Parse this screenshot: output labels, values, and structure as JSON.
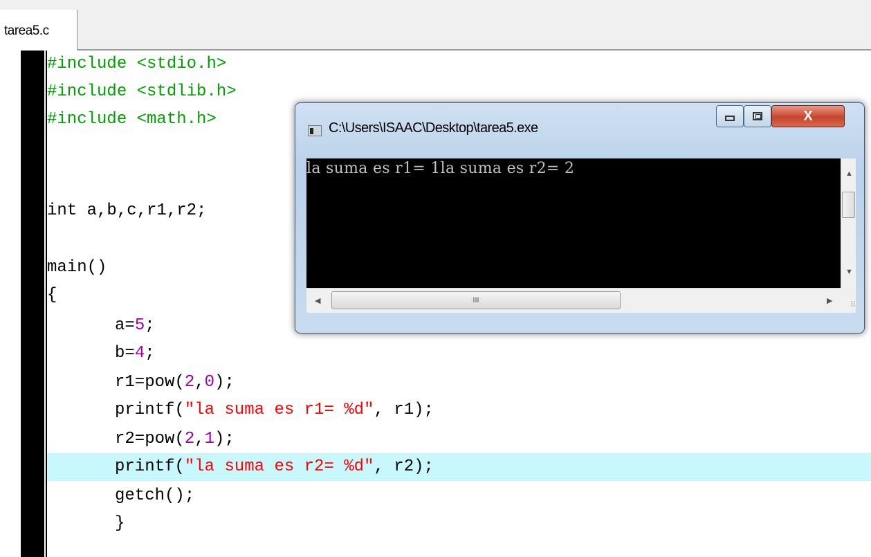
{
  "tab": {
    "label": "tarea5.c"
  },
  "code_lines": [
    {
      "segments": [
        {
          "cls": "pp",
          "text": "#include <stdio.h>"
        }
      ]
    },
    {
      "segments": [
        {
          "cls": "pp",
          "text": "#include <stdlib.h>"
        }
      ]
    },
    {
      "segments": [
        {
          "cls": "pp",
          "text": "#include <math.h>"
        }
      ]
    },
    {
      "segments": []
    },
    {
      "segments": []
    },
    {
      "segments": [
        {
          "cls": "",
          "text": "int a,b,c,r1,r2;"
        }
      ]
    },
    {
      "segments": []
    },
    {
      "segments": [
        {
          "cls": "",
          "text": "main()"
        }
      ]
    },
    {
      "segments": [
        {
          "cls": "",
          "text": "{"
        }
      ]
    },
    {
      "indent": true,
      "segments": [
        {
          "cls": "",
          "text": "a="
        },
        {
          "cls": "num",
          "text": "5"
        },
        {
          "cls": "",
          "text": ";"
        }
      ]
    },
    {
      "indent": true,
      "segments": [
        {
          "cls": "",
          "text": "b="
        },
        {
          "cls": "num",
          "text": "4"
        },
        {
          "cls": "",
          "text": ";"
        }
      ]
    },
    {
      "indent": true,
      "segments": [
        {
          "cls": "",
          "text": "r1=pow("
        },
        {
          "cls": "num",
          "text": "2"
        },
        {
          "cls": "",
          "text": ","
        },
        {
          "cls": "num",
          "text": "0"
        },
        {
          "cls": "",
          "text": ");"
        }
      ]
    },
    {
      "indent": true,
      "segments": [
        {
          "cls": "",
          "text": "printf("
        },
        {
          "cls": "str",
          "text": "\"la suma es r1= %d\""
        },
        {
          "cls": "",
          "text": ", r1);"
        }
      ]
    },
    {
      "indent": true,
      "segments": [
        {
          "cls": "",
          "text": "r2=pow("
        },
        {
          "cls": "num",
          "text": "2"
        },
        {
          "cls": "",
          "text": ","
        },
        {
          "cls": "num",
          "text": "1"
        },
        {
          "cls": "",
          "text": ");"
        }
      ]
    },
    {
      "indent": true,
      "highlight": true,
      "segments": [
        {
          "cls": "",
          "text": "printf("
        },
        {
          "cls": "str",
          "text": "\"la suma es r2= %d\""
        },
        {
          "cls": "",
          "text": ", r2);"
        }
      ]
    },
    {
      "indent": true,
      "segments": [
        {
          "cls": "",
          "text": "getch();"
        }
      ]
    },
    {
      "indent": true,
      "segments": [
        {
          "cls": "",
          "text": "}"
        }
      ]
    }
  ],
  "console_window": {
    "title": "C:\\Users\\ISAAC\\Desktop\\tarea5.exe",
    "output": "la suma es r1= 1la suma es r2= 2",
    "close_glyph": "X",
    "hscroll_grip": "III"
  },
  "colors": {
    "preprocessor": "#00a000",
    "number": "#a000a0",
    "string": "#ff0000",
    "highlight_line": "#c8f8fd"
  }
}
